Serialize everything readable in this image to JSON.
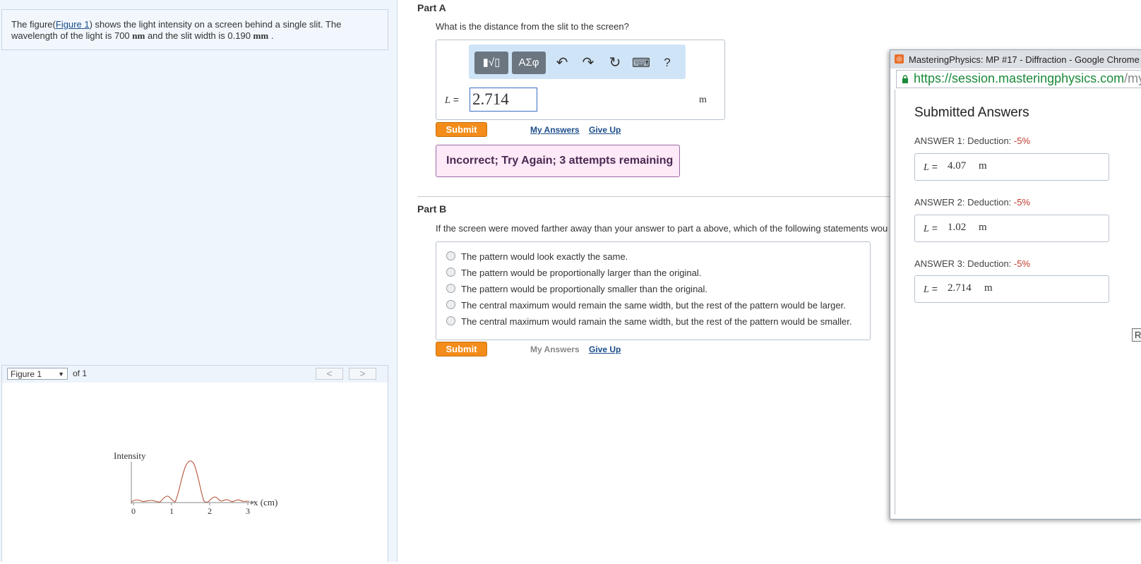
{
  "problem": {
    "text_before": "The figure(",
    "figure_link": "Figure 1",
    "text_mid": ") shows the light intensity on a screen behind a single slit. The wavelength of the light is 700 ",
    "unit_nm": "nm",
    "text_mid2": " and the slit width is 0.190 ",
    "unit_mm": "mm",
    "text_end": " ."
  },
  "figure_nav": {
    "selected": "Figure 1",
    "of_text": "of 1",
    "prev": "<",
    "next": ">"
  },
  "figure": {
    "ylabel": "Intensity",
    "xlabel": "x (cm)",
    "ticks": [
      "0",
      "1",
      "2",
      "3"
    ]
  },
  "part_a": {
    "title": "Part A",
    "question": "What is the distance from the slit to the screen?",
    "toolbar": {
      "template_label": "▮√▯",
      "greek_label": "ΑΣφ",
      "undo": "↶",
      "redo": "↷",
      "reset": "↻",
      "keyboard": "⌨",
      "help": "?"
    },
    "variable": "L",
    "equals": "=",
    "input_value": "2.714",
    "unit": "m",
    "submit": "Submit",
    "my_answers": "My Answers",
    "give_up": "Give Up",
    "feedback": "Incorrect; Try Again; 3 attempts remaining"
  },
  "part_b": {
    "title": "Part B",
    "question": "If the screen were moved farther away than your answer to part a above, which of the following statements wou",
    "options": [
      "The pattern would look exactly the same.",
      "The pattern would be proportionally larger than the original.",
      "The pattern would be proportionally smaller than the original.",
      "The central maximum would remain the same width, but the rest of the pattern would be larger.",
      "The central maximum would ramain the same width, but the rest of the pattern would be smaller."
    ],
    "submit": "Submit",
    "my_answers": "My Answers",
    "give_up": "Give Up"
  },
  "popup": {
    "window_title": "MasteringPhysics: MP #17 - Diffraction - Google Chrome",
    "url_main": "https://session.masteringphysics.com",
    "url_rest": "/myc",
    "heading": "Submitted Answers",
    "answers": [
      {
        "label": "ANSWER 1:",
        "deduction_text": "Deduction:",
        "deduction": "-5%",
        "variable": "L",
        "equals": "=",
        "value": "4.07",
        "unit": "m"
      },
      {
        "label": "ANSWER 2:",
        "deduction_text": "Deduction:",
        "deduction": "-5%",
        "variable": "L",
        "equals": "=",
        "value": "1.02",
        "unit": "m"
      },
      {
        "label": "ANSWER 3:",
        "deduction_text": "Deduction:",
        "deduction": "-5%",
        "variable": "L",
        "equals": "=",
        "value": "2.714",
        "unit": "m"
      }
    ],
    "button_partial": "Re"
  },
  "colors": {
    "accent_orange": "#f38c1a",
    "link_blue": "#1a4c8a",
    "deduction_red": "#c0392b",
    "curve": "#b5563c"
  }
}
